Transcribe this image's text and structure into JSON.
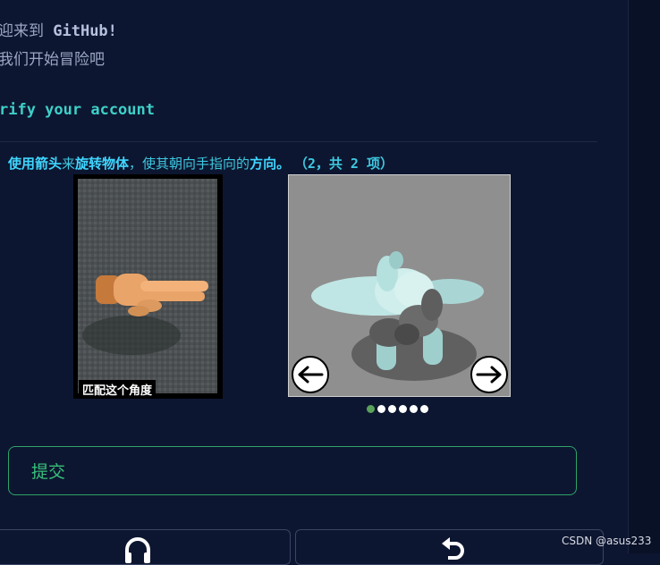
{
  "header": {
    "welcome_prefix": "迎来到 ",
    "welcome_brand": "GitHub!",
    "adventure": "我们开始冒险吧"
  },
  "verify_title": "rify your account",
  "instruction": {
    "part1": "使用箭头",
    "part2": "来",
    "part3": "旋转物体",
    "part4": "，使其朝向手指向的",
    "part5": "方向。",
    "count": "（2，共 2 项）"
  },
  "reference": {
    "label": "匹配这个角度",
    "image_icon": "pointing-hand-icon"
  },
  "object_viewer": {
    "image_icon": "airplane-toy-icon",
    "left_arrow_icon": "arrow-left-icon",
    "right_arrow_icon": "arrow-right-icon",
    "total_steps": 6,
    "active_step": 1
  },
  "submit_label": "提交",
  "bottom_buttons": [
    {
      "icon": "audio-headset-icon"
    },
    {
      "icon": "restart-icon"
    }
  ],
  "watermark": "CSDN @asus233",
  "colors": {
    "background": "#0d1630",
    "accent_teal": "#3ed0c8",
    "instruction": "#3ec8e0",
    "submit_green": "#37c07a",
    "active_dot": "#5aa25a"
  }
}
